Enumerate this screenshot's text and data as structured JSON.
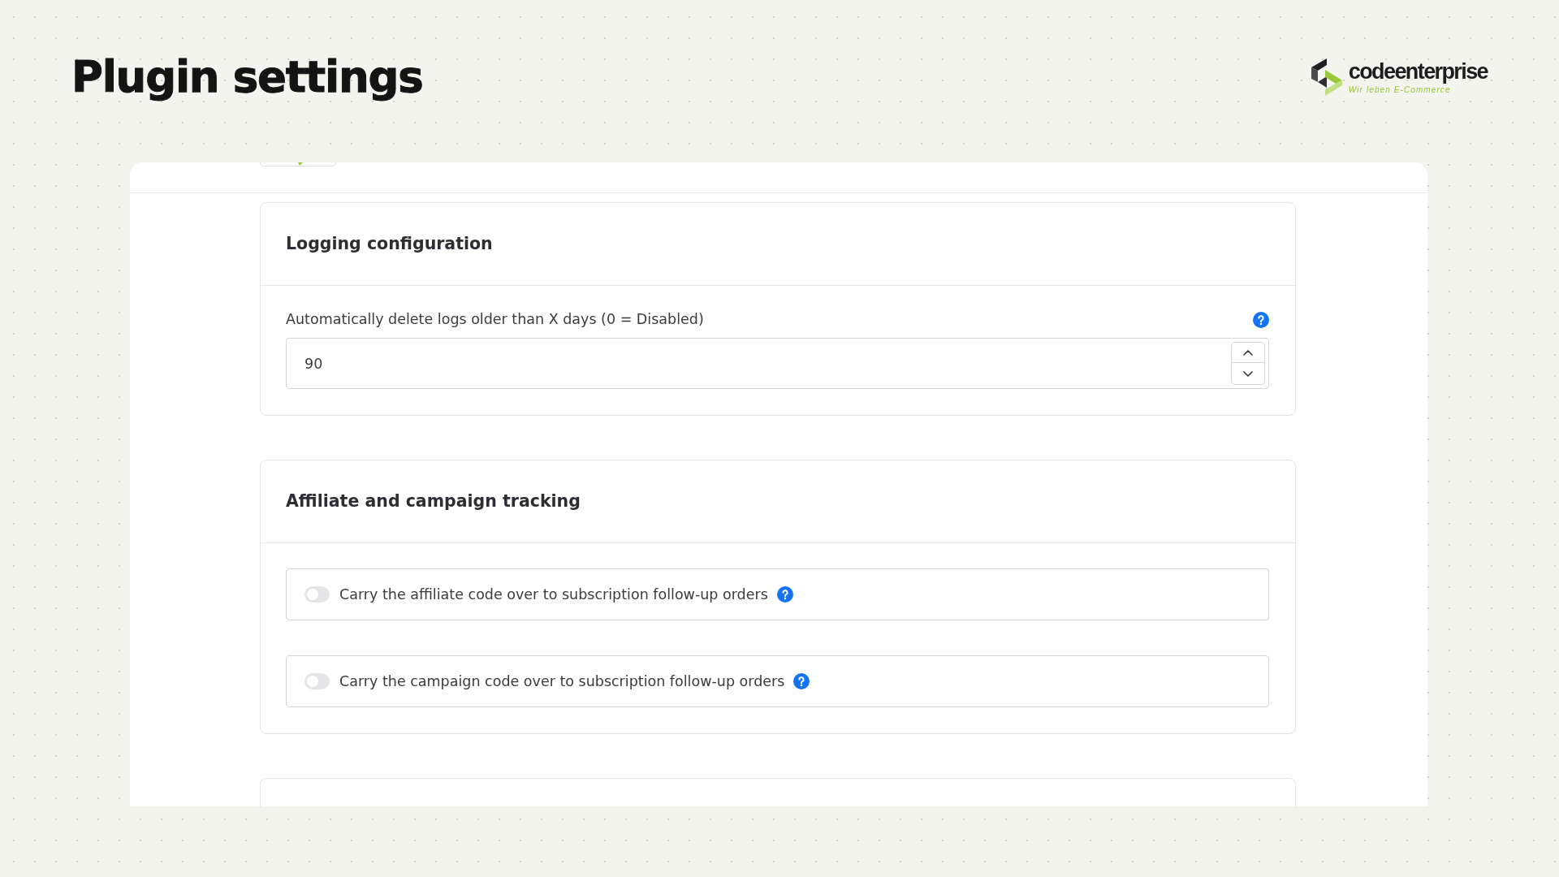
{
  "page": {
    "title": "Plugin settings"
  },
  "logo": {
    "wordmark": "codeenterprise",
    "tagline": "Wir leben E-Commerce"
  },
  "sections": [
    {
      "title": "Logging configuration",
      "fields": [
        {
          "kind": "number",
          "label": "Automatically delete logs older than X days (0 = Disabled)",
          "value": "90",
          "help": true
        }
      ]
    },
    {
      "title": "Affiliate and campaign tracking",
      "fields": [
        {
          "kind": "toggle",
          "label": "Carry the affiliate code over to subscription follow-up orders",
          "on": false,
          "help": true
        },
        {
          "kind": "toggle",
          "label": "Carry the campaign code over to subscription follow-up orders",
          "on": false,
          "help": true
        }
      ]
    }
  ]
}
